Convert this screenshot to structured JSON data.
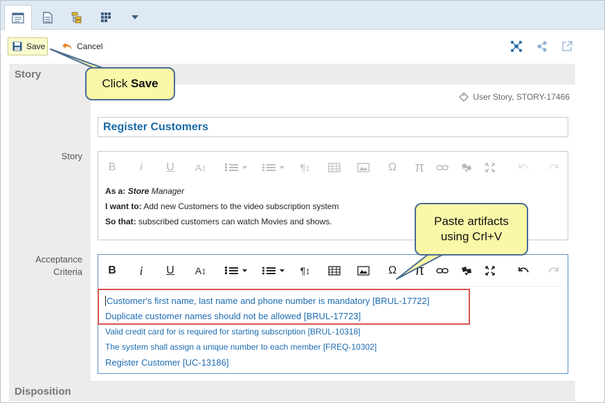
{
  "toolbar": {
    "save_label": "Save",
    "cancel_label": "Cancel"
  },
  "sections": {
    "story": "Story",
    "disposition": "Disposition"
  },
  "item_type": "User Story, STORY-17466",
  "title": "Register Customers",
  "fields": {
    "story_label": "Story",
    "acceptance_label_1": "Acceptance",
    "acceptance_label_2": "Criteria"
  },
  "story": {
    "as_a_label": "As a:",
    "as_a_value": "Store",
    "as_a_value_2": "Manager",
    "want_label": "I want to:",
    "want_value": "Add new Customers to the video subscription system",
    "so_label": "So that:",
    "so_value": "subscribed customers can watch Movies and shows."
  },
  "acceptance": [
    "Customer's first name, last name and phone number is mandatory [BRUL-17722]",
    "Duplicate customer names should not be allowed [BRUL-17723]",
    "Valid credit card for is required for starting subscription [BRUL-10318]",
    "The system shall assign a unique number to each member [FREQ-10302]",
    "Register Customer [UC-13186]"
  ],
  "editor_buttons": {
    "bold": "B",
    "italic": "i",
    "underline": "U",
    "font_size": "A↕",
    "paragraph": "¶↕",
    "omega": "Ω",
    "pi": "π"
  },
  "callouts": {
    "save_prefix": "Click",
    "save_bold": "Save",
    "paste_line_1": "Paste artifacts",
    "paste_line_2": "using Crl+V"
  },
  "colors": {
    "accent": "#1a6aa6",
    "link": "#1d6cb0",
    "highlight_border": "#d9534f",
    "callout_fill": "#fbf7a8",
    "callout_border": "#4a6c92",
    "save_button": "#fbfbd0"
  },
  "icons": {
    "tab_1": "form-icon",
    "tab_2": "document-icon",
    "tab_3": "hierarchy-icon",
    "tab_4": "grid-icon",
    "tab_more": "chevron-down-icon",
    "relations": "network-icon",
    "share": "share-icon",
    "external": "external-link-icon"
  }
}
